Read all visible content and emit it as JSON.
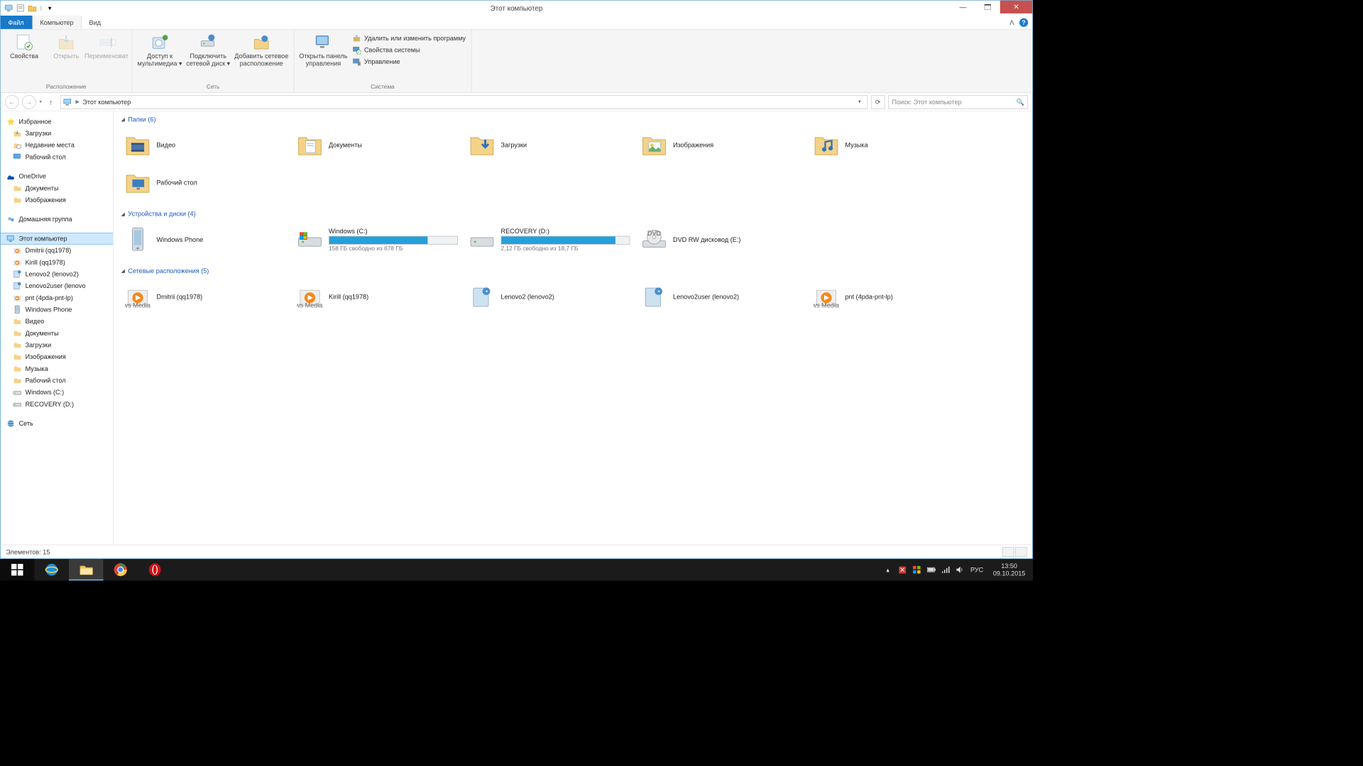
{
  "qat": {
    "dropdown": "▾"
  },
  "title": "Этот компьютер",
  "tabs": {
    "file": "Файл",
    "computer": "Компьютер",
    "view": "Вид"
  },
  "ribbon": {
    "g1": {
      "label": "Расположение",
      "properties": "Свойства",
      "open": "Открыть",
      "rename": "Переименовать"
    },
    "g2": {
      "label": "Сеть",
      "media": "Доступ к\nмультимедиа ▾",
      "netdrive": "Подключить\nсетевой диск ▾",
      "addnet": "Добавить сетевое\nрасположение"
    },
    "g3": {
      "label": "Система",
      "panel": "Открыть панель\nуправления",
      "prog": "Удалить или изменить программу",
      "sysprop": "Свойства системы",
      "manage": "Управление"
    }
  },
  "addr": {
    "location": "Этот компьютер",
    "search_ph": "Поиск: Этот компьютер"
  },
  "nav": {
    "fav": {
      "root": "Избранное",
      "downloads": "Загрузки",
      "recent": "Недавние места",
      "desktop": "Рабочий стол"
    },
    "onedrive": {
      "root": "OneDrive",
      "docs": "Документы",
      "pics": "Изображения"
    },
    "homegroup": "Домашняя группа",
    "pc": {
      "root": "Этот компьютер",
      "i": [
        "Dmitrii (qq1978)",
        "Kirill (qq1978)",
        "Lenovo2 (lenovo2)",
        "Lenovo2user (lenovo",
        "pnt (4pda-pnt-lp)",
        "Windows Phone",
        "Видео",
        "Документы",
        "Загрузки",
        "Изображения",
        "Музыка",
        "Рабочий стол",
        "Windows (C:)",
        "RECOVERY (D:)"
      ]
    },
    "network": "Сеть"
  },
  "sections": {
    "folders": {
      "title": "Папки (6)",
      "items": [
        "Видео",
        "Документы",
        "Загрузки",
        "Изображения",
        "Музыка",
        "Рабочий стол"
      ]
    },
    "devices": {
      "title": "Устройства и диски (4)",
      "phone": "Windows Phone",
      "c": {
        "name": "Windows (C:)",
        "sub": "158 ГБ свободно из 678 ГБ",
        "pct": 77
      },
      "d": {
        "name": "RECOVERY (D:)",
        "sub": "2,12 ГБ свободно из 18,7 ГБ",
        "pct": 89
      },
      "dvd": "DVD RW дисковод (E:)"
    },
    "netloc": {
      "title": "Сетевые расположения (5)",
      "items": [
        "Dmitrii (qq1978)",
        "Kirill (qq1978)",
        "Lenovo2 (lenovo2)",
        "Lenovo2user (lenovo2)",
        "pnt (4pda-pnt-lp)"
      ]
    }
  },
  "status": {
    "count": "Элементов: 15"
  },
  "tray": {
    "lang": "РУС",
    "time": "13:50",
    "date": "09.10.2015"
  }
}
